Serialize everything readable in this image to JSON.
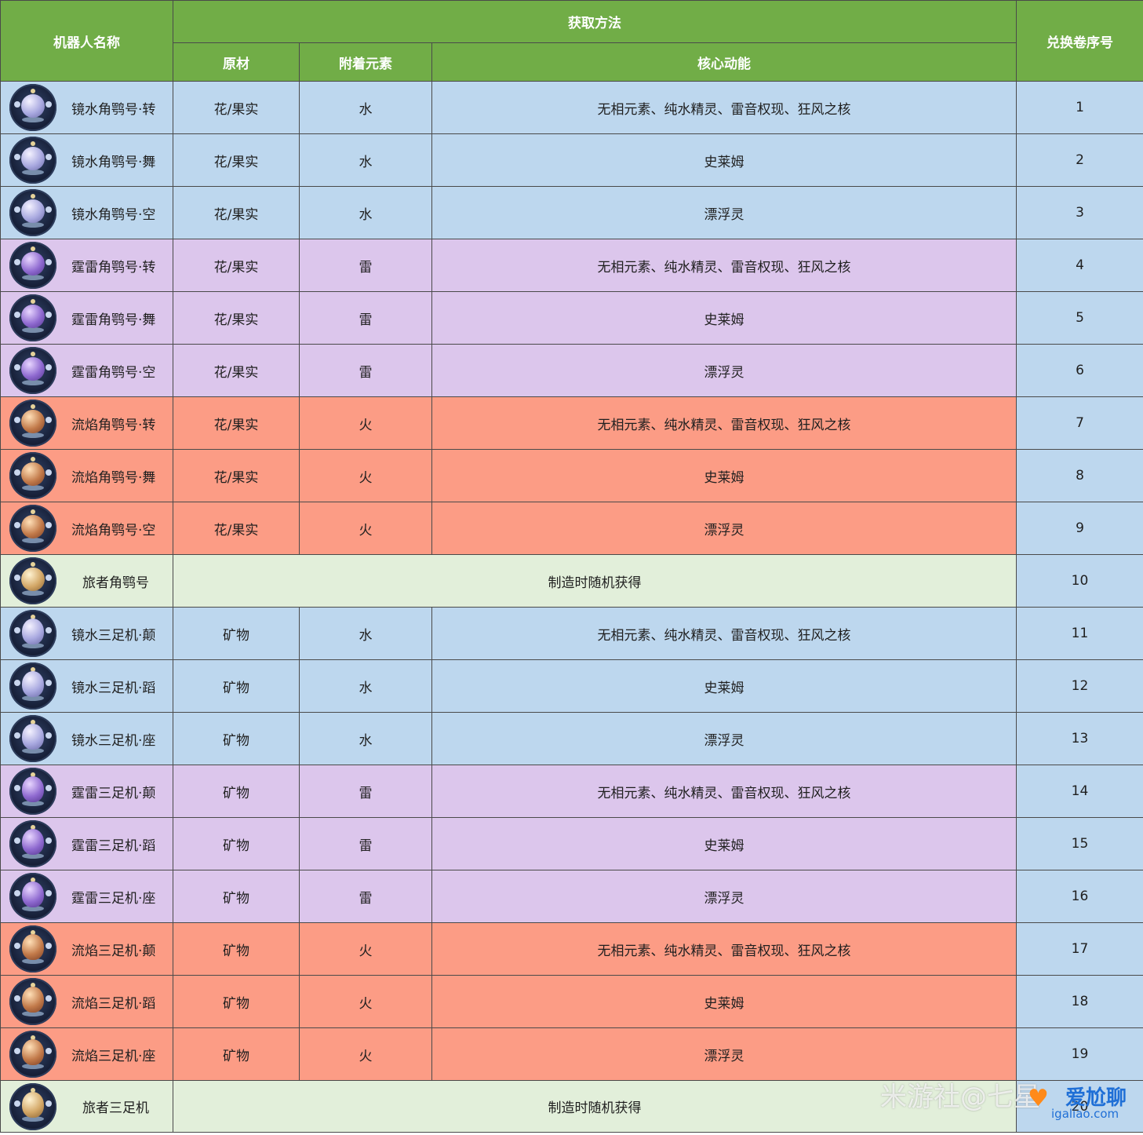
{
  "header": {
    "robot_name": "机器人名称",
    "method": "获取方法",
    "material": "原材",
    "element": "附着元素",
    "core": "核心动能",
    "exchange_no": "兑换卷序号"
  },
  "rows": [
    {
      "name": "镜水角鹗号·转",
      "material": "花/果实",
      "element": "水",
      "core": "无相元素、纯水精灵、雷音权现、狂风之核",
      "no": "1",
      "theme": "water",
      "robot": "horn"
    },
    {
      "name": "镜水角鹗号·舞",
      "material": "花/果实",
      "element": "水",
      "core": "史莱姆",
      "no": "2",
      "theme": "water",
      "robot": "horn"
    },
    {
      "name": "镜水角鹗号·空",
      "material": "花/果实",
      "element": "水",
      "core": "漂浮灵",
      "no": "3",
      "theme": "water",
      "robot": "horn"
    },
    {
      "name": "霆雷角鹗号·转",
      "material": "花/果实",
      "element": "雷",
      "core": "无相元素、纯水精灵、雷音权现、狂风之核",
      "no": "4",
      "theme": "thunder",
      "robot": "horn"
    },
    {
      "name": "霆雷角鹗号·舞",
      "material": "花/果实",
      "element": "雷",
      "core": "史莱姆",
      "no": "5",
      "theme": "thunder",
      "robot": "horn"
    },
    {
      "name": "霆雷角鹗号·空",
      "material": "花/果实",
      "element": "雷",
      "core": "漂浮灵",
      "no": "6",
      "theme": "thunder",
      "robot": "horn"
    },
    {
      "name": "流焰角鹗号·转",
      "material": "花/果实",
      "element": "火",
      "core": "无相元素、纯水精灵、雷音权现、狂风之核",
      "no": "7",
      "theme": "fire",
      "robot": "horn"
    },
    {
      "name": "流焰角鹗号·舞",
      "material": "花/果实",
      "element": "火",
      "core": "史莱姆",
      "no": "8",
      "theme": "fire",
      "robot": "horn"
    },
    {
      "name": "流焰角鹗号·空",
      "material": "花/果实",
      "element": "火",
      "core": "漂浮灵",
      "no": "9",
      "theme": "fire",
      "robot": "horn"
    },
    {
      "name": "旅者角鹗号",
      "random": "制造时随机获得",
      "no": "10",
      "theme": "random",
      "robot": "horn"
    },
    {
      "name": "镜水三足机·颠",
      "material": "矿物",
      "element": "水",
      "core": "无相元素、纯水精灵、雷音权现、狂风之核",
      "no": "11",
      "theme": "water",
      "robot": "tri"
    },
    {
      "name": "镜水三足机·蹈",
      "material": "矿物",
      "element": "水",
      "core": "史莱姆",
      "no": "12",
      "theme": "water",
      "robot": "tri"
    },
    {
      "name": "镜水三足机·座",
      "material": "矿物",
      "element": "水",
      "core": "漂浮灵",
      "no": "13",
      "theme": "water",
      "robot": "tri"
    },
    {
      "name": "霆雷三足机·颠",
      "material": "矿物",
      "element": "雷",
      "core": "无相元素、纯水精灵、雷音权现、狂风之核",
      "no": "14",
      "theme": "thunder",
      "robot": "tri"
    },
    {
      "name": "霆雷三足机·蹈",
      "material": "矿物",
      "element": "雷",
      "core": "史莱姆",
      "no": "15",
      "theme": "thunder",
      "robot": "tri"
    },
    {
      "name": "霆雷三足机·座",
      "material": "矿物",
      "element": "雷",
      "core": "漂浮灵",
      "no": "16",
      "theme": "thunder",
      "robot": "tri"
    },
    {
      "name": "流焰三足机·颠",
      "material": "矿物",
      "element": "火",
      "core": "无相元素、纯水精灵、雷音权现、狂风之核",
      "no": "17",
      "theme": "fire",
      "robot": "tri"
    },
    {
      "name": "流焰三足机·蹈",
      "material": "矿物",
      "element": "火",
      "core": "史莱姆",
      "no": "18",
      "theme": "fire",
      "robot": "tri"
    },
    {
      "name": "流焰三足机·座",
      "material": "矿物",
      "element": "火",
      "core": "漂浮灵",
      "no": "19",
      "theme": "fire",
      "robot": "tri"
    },
    {
      "name": "旅者三足机",
      "random": "制造时随机获得",
      "no": "20",
      "theme": "random",
      "robot": "tri"
    }
  ],
  "colors": {
    "header_green": "#71ad47",
    "water_blue": "#bdd7ee",
    "thunder_purple": "#dcc6ec",
    "fire_red": "#fc9c85",
    "random_green": "#e2efda"
  },
  "watermark": {
    "text": "米游社@七星",
    "logo_main": "爱尬聊",
    "logo_sub": "igaliao.com"
  }
}
